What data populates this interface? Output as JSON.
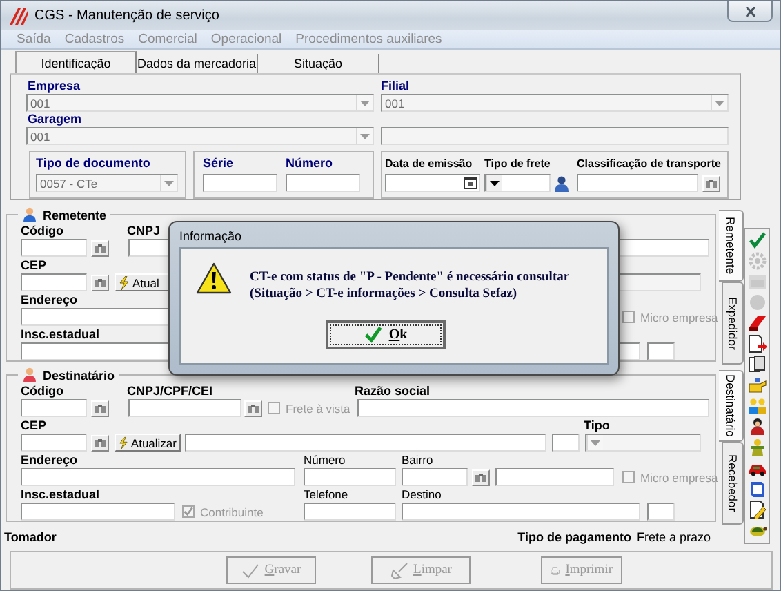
{
  "window": {
    "title": "CGS - Manutenção de serviço"
  },
  "menu": [
    {
      "label": "Saída",
      "disabled": true
    },
    {
      "label": "Cadastros",
      "disabled": true
    },
    {
      "label": "Comercial",
      "disabled": true
    },
    {
      "label": "Operacional",
      "disabled": true
    },
    {
      "label": "Procedimentos auxiliares",
      "disabled": true
    }
  ],
  "tabs": [
    {
      "label": "Identificação",
      "selected": true
    },
    {
      "label": "Dados da mercadoria",
      "selected": false
    },
    {
      "label": "Situação",
      "selected": false
    }
  ],
  "identification": {
    "empresa": {
      "label": "Empresa",
      "value": "001"
    },
    "filial": {
      "label": "Filial",
      "value": "001"
    },
    "garagem": {
      "label": "Garagem",
      "value": "001"
    },
    "document_type": {
      "label": "Tipo de documento",
      "value": "0057 - CTe"
    },
    "serie": {
      "label": "Série"
    },
    "numero": {
      "label": "Número"
    },
    "issue_date": {
      "label": "Data de emissão"
    },
    "freight_type": {
      "label": "Tipo de frete"
    },
    "transport_class": {
      "label": "Classificação de transporte"
    }
  },
  "sender": {
    "title": "Remetente",
    "code": "Código",
    "cnpj": "CNPJ",
    "cep": "CEP",
    "update": "Atual",
    "address": "Endereço",
    "state_reg": "Insc.estadual",
    "micro": {
      "label": "Micro empresa",
      "checked": false,
      "disabled": true
    }
  },
  "recipient": {
    "title": "Destinatário",
    "code": "Código",
    "cnpj": "CNPJ/CPF/CEI",
    "cash_freight": {
      "label": "Frete à vista",
      "checked": false,
      "disabled": true
    },
    "company_name": "Razão social",
    "cep": "CEP",
    "update": "Atualizar",
    "type": "Tipo",
    "address": "Endereço",
    "number": "Número",
    "district": "Bairro",
    "micro": {
      "label": "Micro empresa",
      "checked": false,
      "disabled": true
    },
    "state_reg": "Insc.estadual",
    "taxpayer": {
      "label": "Contribuinte",
      "checked": true,
      "disabled": true
    },
    "phone": "Telefone",
    "destination": "Destino"
  },
  "side_tabs_upper": [
    {
      "label": "Remetente",
      "selected": true
    },
    {
      "label": "Expedidor",
      "selected": false
    }
  ],
  "side_tabs_lower": [
    {
      "label": "Destinatário",
      "selected": true
    },
    {
      "label": "Recebedor",
      "selected": false
    }
  ],
  "toolbar": [
    {
      "kind": "check",
      "disabled": false
    },
    {
      "kind": "gear",
      "disabled": true
    },
    {
      "kind": "card",
      "disabled": true
    },
    {
      "kind": "circle",
      "disabled": true
    },
    {
      "kind": "eraser",
      "disabled": false
    },
    {
      "kind": "doc_arrow",
      "disabled": false
    },
    {
      "kind": "pages",
      "disabled": false
    },
    {
      "kind": "hand",
      "disabled": false
    },
    {
      "kind": "people",
      "disabled": false
    },
    {
      "kind": "person",
      "disabled": false
    },
    {
      "kind": "figure",
      "disabled": false
    },
    {
      "kind": "car",
      "disabled": false
    },
    {
      "kind": "book",
      "disabled": false
    },
    {
      "kind": "doc_pencil",
      "disabled": false
    },
    {
      "kind": "turtle",
      "disabled": false
    }
  ],
  "tomador": {
    "label": "Tomador",
    "payment_label": "Tipo de pagamento",
    "payment_value": "Frete a prazo"
  },
  "buttons": [
    {
      "kind": "save",
      "label": "Gravar",
      "disabled": true
    },
    {
      "kind": "clear",
      "label": "Limpar",
      "disabled": true
    },
    {
      "kind": "print",
      "label": "Imprimir",
      "disabled": true
    }
  ],
  "dialog": {
    "title": "Informação",
    "lines": [
      "CT-e com status de \"P - Pendente\" é necessário consultar",
      "(Situação > CT-e informações > Consulta Sefaz)"
    ],
    "ok": "Ok"
  }
}
